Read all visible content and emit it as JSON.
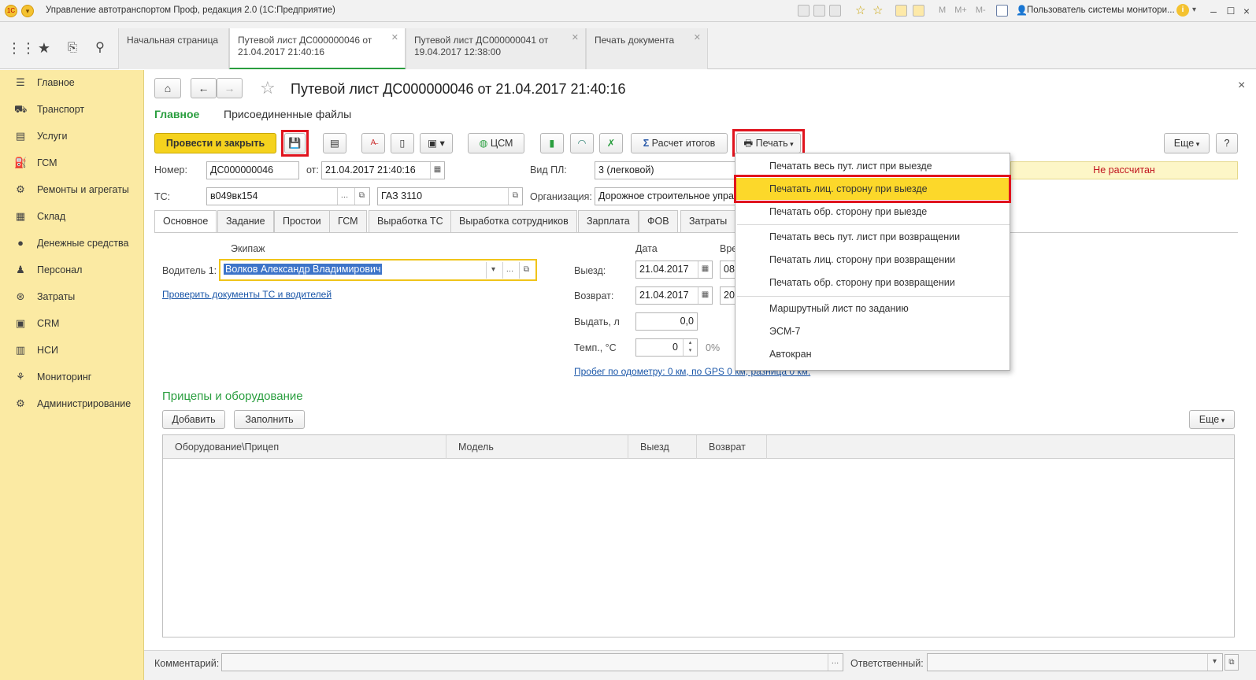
{
  "window": {
    "title": "Управление автотранспортом Проф, редакция 2.0 (1С:Предприятие)",
    "user": "Пользователь системы монитори...",
    "mem_buttons": [
      "M",
      "M+",
      "M-"
    ]
  },
  "tabs": [
    {
      "label": "Начальная страница",
      "active": false
    },
    {
      "label": "Путевой лист ДС000000046 от 21.04.2017 21:40:16",
      "active": true
    },
    {
      "label": "Путевой лист ДС000000041 от 19.04.2017 12:38:00",
      "active": false
    },
    {
      "label": "Печать документа",
      "active": false
    }
  ],
  "sidebar": {
    "items": [
      {
        "label": "Главное",
        "icon": "list-icon"
      },
      {
        "label": "Транспорт",
        "icon": "truck-icon"
      },
      {
        "label": "Услуги",
        "icon": "services-icon"
      },
      {
        "label": "ГСМ",
        "icon": "fuel-icon"
      },
      {
        "label": "Ремонты и агрегаты",
        "icon": "wrench-icon"
      },
      {
        "label": "Склад",
        "icon": "warehouse-icon"
      },
      {
        "label": "Денежные средства",
        "icon": "money-icon"
      },
      {
        "label": "Персонал",
        "icon": "person-icon"
      },
      {
        "label": "Затраты",
        "icon": "costs-icon"
      },
      {
        "label": "CRM",
        "icon": "crm-icon"
      },
      {
        "label": "НСИ",
        "icon": "reference-icon"
      },
      {
        "label": "Мониторинг",
        "icon": "monitoring-icon"
      },
      {
        "label": "Администрирование",
        "icon": "gear-icon"
      }
    ]
  },
  "form": {
    "title": "Путевой лист ДС000000046 от 21.04.2017 21:40:16",
    "subnav": {
      "main": "Главное",
      "files": "Присоединенные файлы"
    },
    "toolbar": {
      "post_close": "Провести и закрыть",
      "csm": "ЦСМ",
      "calc_totals": "Расчет итогов",
      "print": "Печать",
      "more": "Еще",
      "help": "?"
    },
    "number_label": "Номер:",
    "number_value": "ДС000000046",
    "from_label": "от:",
    "date_value": "21.04.2017 21:40:16",
    "pl_type_label": "Вид ПЛ:",
    "pl_type_value": "3 (легковой)",
    "status": "Не рассчитан",
    "ts_label": "ТС:",
    "ts_value": "в049вк154",
    "model_value": "ГАЗ 3110",
    "org_label": "Организация:",
    "org_value": "Дорожное строительное упра",
    "tabs": [
      "Основное",
      "Задание",
      "Простои",
      "ГСМ",
      "Выработка ТС",
      "Выработка сотрудников",
      "Зарплата",
      "ФОВ",
      "Затраты"
    ],
    "crew_header": "Экипаж",
    "driver_label": "Водитель 1:",
    "driver_value": "Волков Александр Владимирович",
    "check_docs_link": "Проверить документы ТС и водителей",
    "date_header": "Дата",
    "time_header": "Вре",
    "departure_label": "Выезд:",
    "departure_date": "21.04.2017",
    "departure_time": "08",
    "return_label": "Возврат:",
    "return_date": "21.04.2017",
    "return_time": "20",
    "issue_label": "Выдать, л",
    "issue_value": "0,0",
    "temp_label": "Темп., °С",
    "temp_value": "0",
    "temp_percent": "0%",
    "mileage_link": "Пробег по одометру: 0 км, по GPS 0 км, разница 0 км.",
    "trailers_title": "Прицепы и оборудование",
    "add_button": "Добавить",
    "fill_button": "Заполнить",
    "table_more": "Еще",
    "table_headers": [
      "Оборудование\\Прицеп",
      "Модель",
      "Выезд",
      "Возврат"
    ],
    "comment_label": "Комментарий:",
    "responsible_label": "Ответственный:"
  },
  "print_menu": {
    "items": [
      "Печатать весь пут. лист при выезде",
      "Печатать лиц. сторону при выезде",
      "Печатать обр. сторону при выезде",
      "Печатать весь пут. лист при возвращении",
      "Печатать лиц. сторону при возвращении",
      "Печатать обр. сторону при возвращении",
      "Маршрутный лист по заданию",
      "ЭСМ-7",
      "Автокран"
    ],
    "highlighted_index": 1
  },
  "colors": {
    "sidebar_bg": "#fbeaa3",
    "primary_button": "#f5d21e",
    "highlight": "#fcd82a",
    "green": "#2a9e3f",
    "red": "#e0141e",
    "status_bg": "#fdf6c7"
  }
}
